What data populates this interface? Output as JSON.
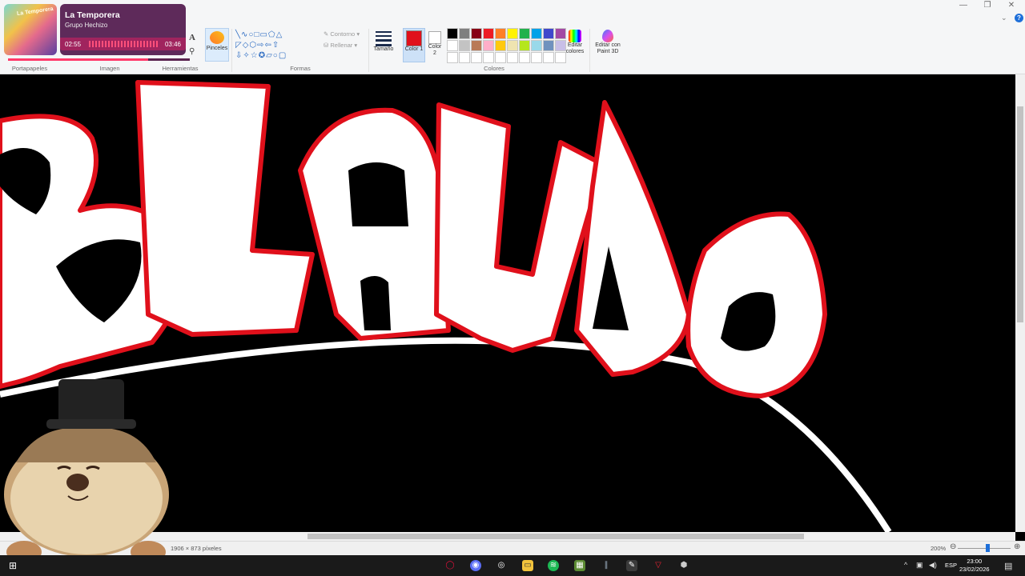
{
  "window": {
    "minimize": "—",
    "maximize": "❐",
    "close": "✕",
    "help": "?"
  },
  "music": {
    "title": "La Temporera",
    "artist": "Grupo Hechizo",
    "current_time": "02:55",
    "total_time": "03:46",
    "progress": 0.77,
    "album_text": "La Temporera"
  },
  "ribbon": {
    "groups": {
      "clipboard": "Portapapeles",
      "image": "Imagen",
      "tools": "Herramientas",
      "shapes": "Formas",
      "colors": "Colores"
    },
    "brushes_label": "Pinceles",
    "text_tool": "A",
    "outline_label": "Contorno",
    "fill_label": "Rellenar",
    "size_label": "Tamaño",
    "color1_label": "Color 1",
    "color2_label": "Color 2",
    "edit_colors_label": "Editar colores",
    "paint3d_label": "Editar con Paint 3D",
    "palette": [
      "#000000",
      "#7f7f7f",
      "#880015",
      "#ed1c24",
      "#ff7f27",
      "#fff200",
      "#22b14c",
      "#00a2e8",
      "#3f48cc",
      "#a349a4",
      "#ffffff",
      "#c3c3c3",
      "#b97a57",
      "#ffaec9",
      "#ffc90e",
      "#efe4b0",
      "#b5e61d",
      "#99d9ea",
      "#7092be",
      "#c8bfe7",
      "#ffffff",
      "#ffffff",
      "#ffffff",
      "#ffffff",
      "#ffffff",
      "#ffffff",
      "#ffffff",
      "#ffffff",
      "#ffffff",
      "#ffffff"
    ],
    "color1": "#e0101b",
    "color2": "#ffffff"
  },
  "status": {
    "dimensions": "1906 × 873 píxeles",
    "zoom": "200%"
  },
  "taskbar": {
    "language": "ESP",
    "time": "23:00",
    "date": "23/02/2026"
  },
  "canvas": {
    "background": "#000000",
    "outline_color": "#e0101b",
    "letters": "BLANDO"
  }
}
